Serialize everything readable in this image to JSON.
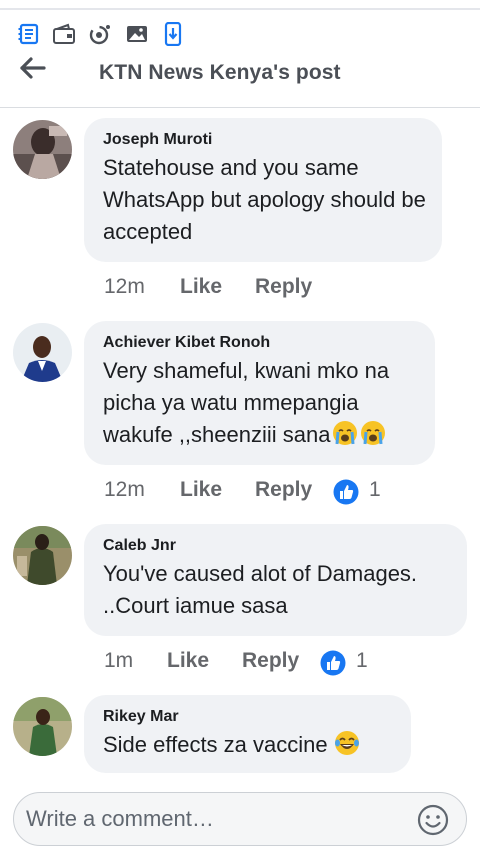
{
  "status_bar": {
    "icons": [
      "notes-icon",
      "wallet-icon",
      "sync-icon",
      "image-icon",
      "download-icon"
    ]
  },
  "header": {
    "title": "KTN News Kenya's post",
    "back_icon": "back-arrow-icon"
  },
  "comments": [
    {
      "author": "Joseph Muroti",
      "text": "Statehouse and you same WhatsApp but apology should be accepted",
      "emoji": [],
      "time": "12m",
      "like_label": "Like",
      "reply_label": "Reply",
      "reaction_count": ""
    },
    {
      "author": "Achiever Kibet Ronoh",
      "text": "Very shameful, kwani mko na picha ya watu mmepangia wakufe ,,sheenziii sana",
      "emoji": [
        "loudly-crying-face",
        "loudly-crying-face"
      ],
      "time": "12m",
      "like_label": "Like",
      "reply_label": "Reply",
      "reaction_count": "1"
    },
    {
      "author": "Caleb Jnr",
      "text": "You've caused alot of Damages. ..Court iamue sasa",
      "emoji": [],
      "time": "1m",
      "like_label": "Like",
      "reply_label": "Reply",
      "reaction_count": "1"
    },
    {
      "author": "Rikey Mar",
      "text": "Side effects za vaccine",
      "emoji": [
        "tears-of-joy-face"
      ],
      "time": "",
      "like_label": "",
      "reply_label": "",
      "reaction_count": ""
    }
  ],
  "composer": {
    "placeholder": "Write a comment…",
    "emoji_icon": "smiley-icon"
  },
  "colors": {
    "accent_blue": "#1877f2",
    "bubble_bg": "#f0f2f5",
    "meta_text": "#65676b"
  }
}
